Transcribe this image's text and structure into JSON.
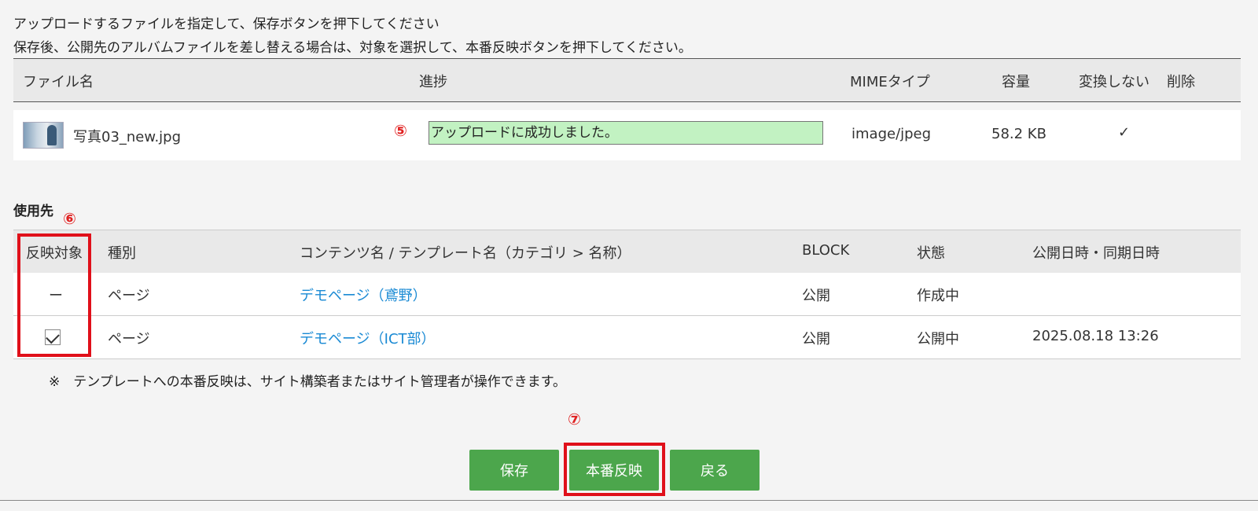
{
  "instructions": {
    "line1": "アップロードするファイルを指定して、保存ボタンを押下してください",
    "line2": "保存後、公開先のアルバムファイルを差し替える場合は、対象を選択して、本番反映ボタンを押下してください。"
  },
  "upload_table": {
    "headers": {
      "filename": "ファイル名",
      "progress": "進捗",
      "mime": "MIMEタイプ",
      "size": "容量",
      "no_convert": "変換しない",
      "delete": "削除"
    },
    "row": {
      "filename": "写真03_new.jpg",
      "step_marker": "⑤",
      "progress_text": "アップロードに成功しました。",
      "progress_color": "#c2f2c2",
      "mime": "image/jpeg",
      "size": "58.2 KB",
      "no_convert": "✓"
    }
  },
  "usage": {
    "title": "使用先",
    "step_marker": "⑥",
    "headers": {
      "target": "反映対象",
      "type": "種別",
      "name": "コンテンツ名 / テンプレート名（カテゴリ > 名称）",
      "block": "BLOCK",
      "status": "状態",
      "date": "公開日時・同期日時"
    },
    "rows": [
      {
        "target": "ー",
        "checked": false,
        "type": "ページ",
        "name": "デモページ（鳶野）",
        "block": "公開",
        "status": "作成中",
        "date": ""
      },
      {
        "target": "",
        "checked": true,
        "type": "ページ",
        "name": "デモページ（ICT部）",
        "block": "公開",
        "status": "公開中",
        "date": "2025.08.18 13:26"
      }
    ],
    "note": "※　テンプレートへの本番反映は、サイト構築者またはサイト管理者が操作できます。"
  },
  "buttons": {
    "step_marker": "⑦",
    "save": "保存",
    "publish": "本番反映",
    "back": "戻る",
    "color": "#4ca64c"
  },
  "highlight_color": "#e0101a"
}
